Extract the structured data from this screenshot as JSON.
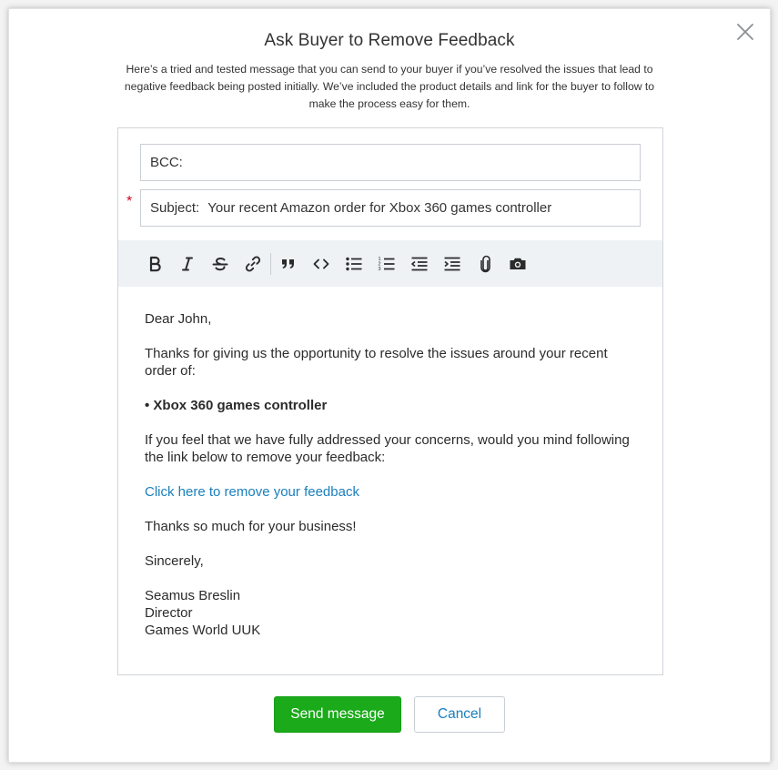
{
  "modal": {
    "title": "Ask Buyer to Remove Feedback",
    "description": "Here’s a tried and tested message that you can send to your buyer if you’ve resolved the issues that lead to negative feedback being posted initially. We’ve included the product details and link for the buyer to follow to make the process easy for them.",
    "close_icon": "close-icon"
  },
  "composer": {
    "bcc": {
      "label": "BCC:",
      "value": ""
    },
    "subject": {
      "required_marker": "*",
      "label": "Subject:",
      "value": "Your recent Amazon order for Xbox 360 games controller"
    },
    "toolbar": [
      "bold-icon",
      "italic-icon",
      "strikethrough-icon",
      "link-icon",
      "quote-icon",
      "code-icon",
      "bulleted-list-icon",
      "numbered-list-icon",
      "outdent-icon",
      "indent-icon",
      "attachment-icon",
      "camera-icon"
    ],
    "body": {
      "greeting": "Dear John,",
      "intro": "Thanks for giving us the opportunity to resolve the issues around your recent order of:",
      "product": "• Xbox 360 games controller",
      "request": "If you feel that we have fully addressed your concerns, would you mind following the link below to remove your feedback:",
      "link_text": "Click here to remove your feedback",
      "thanks": "Thanks so much for your business!",
      "signoff": "Sincerely,",
      "signature_name": "Seamus Breslin",
      "signature_title": "Director",
      "signature_company": "Games World UUK"
    }
  },
  "actions": {
    "send_label": "Send message",
    "cancel_label": "Cancel"
  },
  "colors": {
    "send_button": "#1aaa1a",
    "link": "#1a7fbd",
    "required": "#d0021b",
    "toolbar_bg": "#eef2f5"
  }
}
